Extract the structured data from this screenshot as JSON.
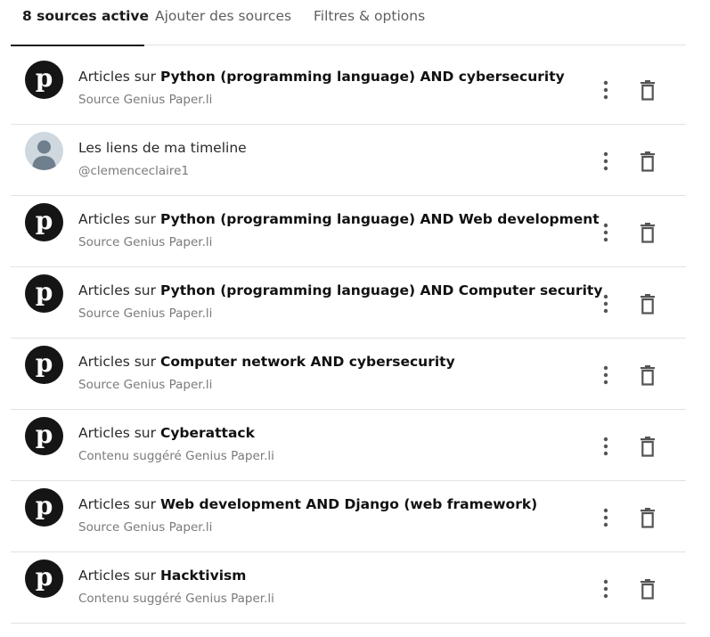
{
  "tabs": [
    {
      "label": "8 sources active",
      "active": true
    },
    {
      "label": "Ajouter des sources",
      "active": false
    },
    {
      "label": "Filtres & options",
      "active": false
    }
  ],
  "sources": [
    {
      "avatar": "paperli-logo",
      "avatar_letter": "p",
      "prefix": "Articles sur ",
      "topic": "Python (programming language) AND cybersecurity",
      "subtitle": "Source Genius Paper.li"
    },
    {
      "avatar": "user-avatar",
      "avatar_letter": "",
      "prefix": "Les liens de ma timeline",
      "topic": "",
      "subtitle": "@clemenceclaire1"
    },
    {
      "avatar": "paperli-logo",
      "avatar_letter": "p",
      "prefix": "Articles sur ",
      "topic": "Python (programming language) AND Web development",
      "subtitle": "Source Genius Paper.li"
    },
    {
      "avatar": "paperli-logo",
      "avatar_letter": "p",
      "prefix": "Articles sur ",
      "topic": "Python (programming language) AND Computer security",
      "subtitle": "Source Genius Paper.li"
    },
    {
      "avatar": "paperli-logo",
      "avatar_letter": "p",
      "prefix": "Articles sur ",
      "topic": "Computer network AND cybersecurity",
      "subtitle": "Source Genius Paper.li"
    },
    {
      "avatar": "paperli-logo",
      "avatar_letter": "p",
      "prefix": "Articles sur ",
      "topic": "Cyberattack",
      "subtitle": "Contenu suggéré Genius Paper.li"
    },
    {
      "avatar": "paperli-logo",
      "avatar_letter": "p",
      "prefix": "Articles sur ",
      "topic": "Web development AND Django (web framework)",
      "subtitle": "Source Genius Paper.li"
    },
    {
      "avatar": "paperli-logo",
      "avatar_letter": "p",
      "prefix": "Articles sur ",
      "topic": "Hacktivism",
      "subtitle": "Contenu suggéré Genius Paper.li"
    }
  ],
  "icons": {
    "menu": "more-vertical-icon",
    "delete": "trash-icon"
  },
  "colors": {
    "active_tab": "#1a1a1a",
    "divider": "#e2e2e2",
    "logo_bg": "#151515",
    "subtitle": "#7a7a7a"
  }
}
